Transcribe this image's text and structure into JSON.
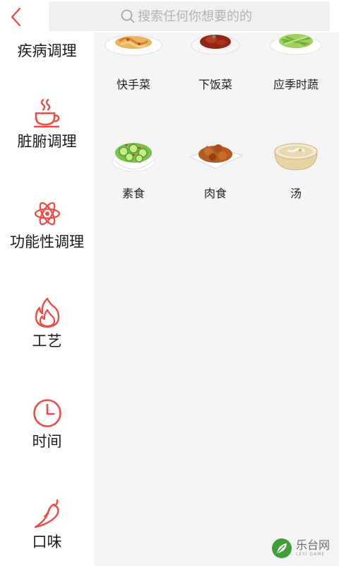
{
  "search": {
    "placeholder": "搜索任何你想要的的"
  },
  "sidebar": {
    "items": [
      {
        "label": "疾病调理",
        "icon": "disease-icon"
      },
      {
        "label": "脏腑调理",
        "icon": "teacup-icon"
      },
      {
        "label": "功能性调理",
        "icon": "atom-icon"
      },
      {
        "label": "工艺",
        "icon": "flame-icon"
      },
      {
        "label": "时间",
        "icon": "clock-icon"
      },
      {
        "label": "口味",
        "icon": "chili-icon"
      }
    ]
  },
  "foods": [
    {
      "label": "快手菜",
      "icon": "noodle-dish-icon"
    },
    {
      "label": "下饭菜",
      "icon": "braised-pork-icon"
    },
    {
      "label": "应季时蔬",
      "icon": "green-vegetable-icon"
    },
    {
      "label": "素食",
      "icon": "cucumber-salad-icon"
    },
    {
      "label": "肉食",
      "icon": "meat-dish-icon"
    },
    {
      "label": "汤",
      "icon": "soup-bowl-icon"
    }
  ],
  "watermark": {
    "main": "乐台网",
    "sub": "LEYI GAME"
  },
  "colors": {
    "accent": "#f04a45",
    "sidebar_bg": "#ffffff",
    "content_bg": "#f4f4f4",
    "search_bg": "#f0f0f0"
  }
}
